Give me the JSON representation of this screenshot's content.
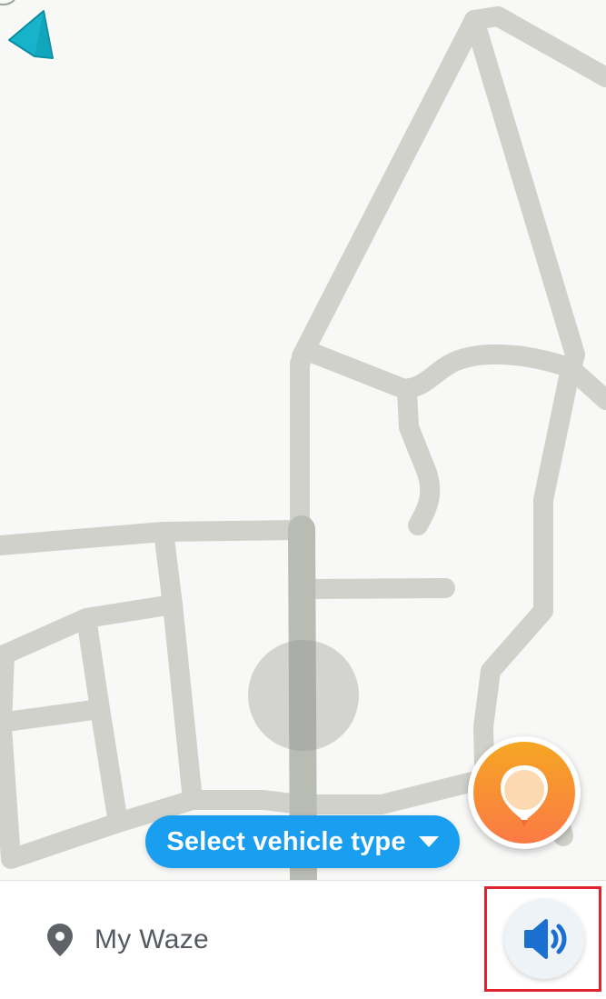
{
  "map": {
    "road_color": "#cfd1ca",
    "main_road_color": "#b9bcb3",
    "background_color": "#f8f8f7",
    "current_position_icon": "navigation-arrow-icon"
  },
  "vehicle_selector": {
    "label": "Select vehicle type",
    "icon": "caret-down-icon",
    "color": "#1a9ef0"
  },
  "report_button": {
    "icon": "report-pin-icon",
    "color": "#f5a623"
  },
  "bottom_bar": {
    "my_waze": {
      "label": "My Waze",
      "icon": "location-pin-icon"
    },
    "sound_button": {
      "icon": "speaker-icon",
      "color": "#1a6fd1"
    }
  },
  "highlight_color": "#e0232e"
}
